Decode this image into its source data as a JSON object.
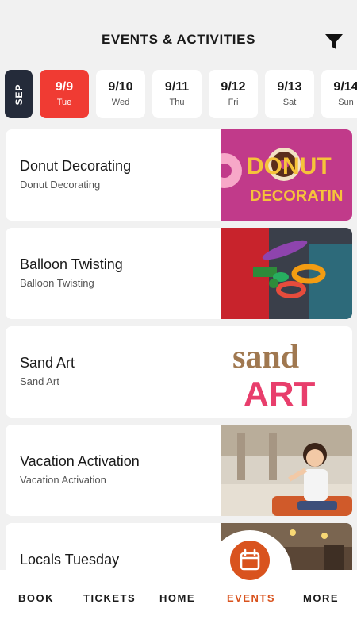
{
  "header": {
    "title": "EVENTS & ACTIVITIES"
  },
  "icons": {
    "filter": "filter-icon",
    "calendar": "calendar-icon"
  },
  "colors": {
    "accent": "#f03b33",
    "nav_active": "#d9531e",
    "month_tab": "#242b3a"
  },
  "date_strip": {
    "month": "SEP",
    "dates": [
      {
        "date": "9/9",
        "day": "Tue",
        "selected": true
      },
      {
        "date": "9/10",
        "day": "Wed",
        "selected": false
      },
      {
        "date": "9/11",
        "day": "Thu",
        "selected": false
      },
      {
        "date": "9/12",
        "day": "Fri",
        "selected": false
      },
      {
        "date": "9/13",
        "day": "Sat",
        "selected": false
      },
      {
        "date": "9/14",
        "day": "Sun",
        "selected": false
      }
    ]
  },
  "events": [
    {
      "title": "Donut Decorating",
      "subtitle": "Donut Decorating",
      "image_text": [
        "DONUT",
        "DECORATIN"
      ]
    },
    {
      "title": "Balloon Twisting",
      "subtitle": "Balloon Twisting"
    },
    {
      "title": "Sand Art",
      "subtitle": "Sand Art",
      "image_text": [
        "sand",
        "ART"
      ]
    },
    {
      "title": "Vacation Activation",
      "subtitle": "Vacation Activation"
    },
    {
      "title": "Locals Tuesday",
      "subtitle": ""
    }
  ],
  "bottom_nav": {
    "items": [
      {
        "label": "BOOK",
        "active": false
      },
      {
        "label": "TICKETS",
        "active": false
      },
      {
        "label": "HOME",
        "active": false
      },
      {
        "label": "EVENTS",
        "active": true
      },
      {
        "label": "MORE",
        "active": false
      }
    ]
  }
}
